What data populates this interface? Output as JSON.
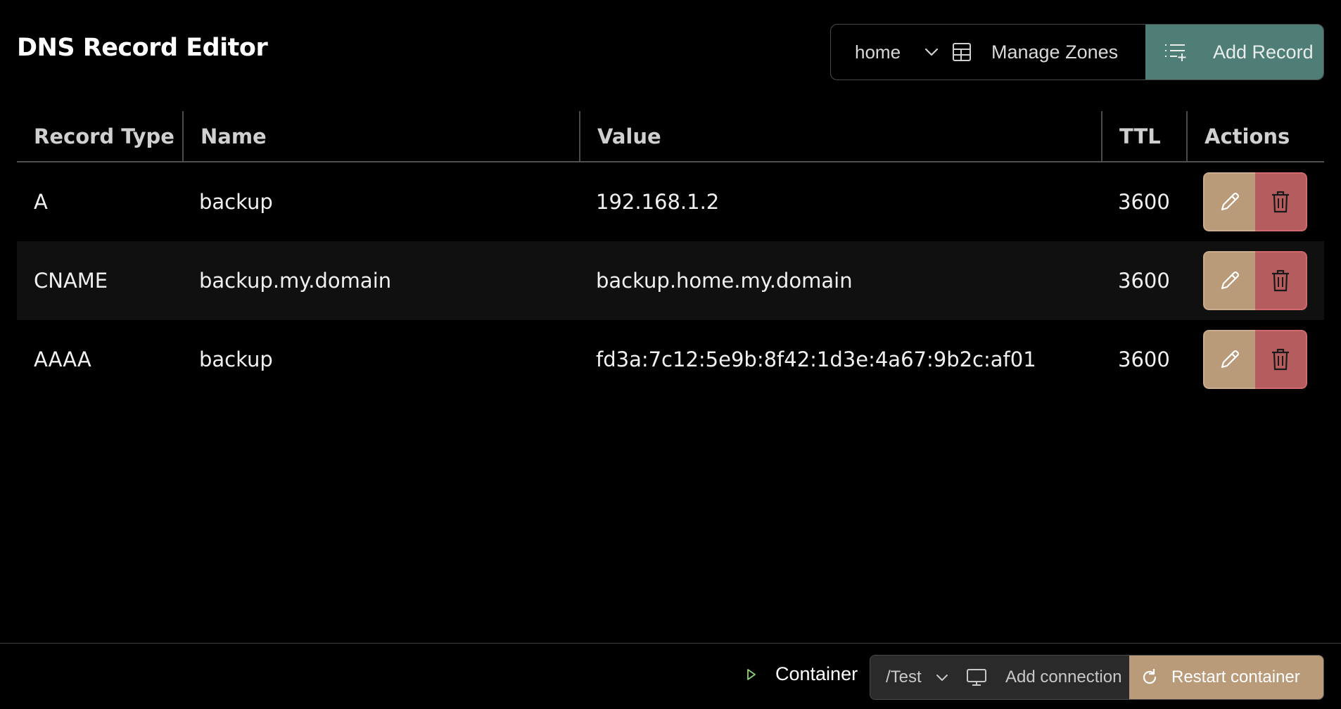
{
  "header": {
    "title": "DNS Record Editor"
  },
  "toolbar": {
    "zone_selected": "home",
    "manage_zones_label": "Manage Zones",
    "add_record_label": "Add Record"
  },
  "table": {
    "columns": [
      "Record Type",
      "Name",
      "Value",
      "TTL",
      "Actions"
    ],
    "rows": [
      {
        "type": "A",
        "name": "backup",
        "value": "192.168.1.2",
        "ttl": "3600"
      },
      {
        "type": "CNAME",
        "name": "backup.my.domain",
        "value": "backup.home.my.domain",
        "ttl": "3600"
      },
      {
        "type": "AAAA",
        "name": "backup",
        "value": "fd3a:7c12:5e9b:8f42:1d3e:4a67:9b2c:af01",
        "ttl": "3600"
      }
    ]
  },
  "bottom_bar": {
    "container_label": "Container",
    "path_selected": "/Test",
    "add_connection_label": "Add connection",
    "restart_label": "Restart container"
  },
  "colors": {
    "background": "#000000",
    "add_record_bg": "#4f7e77",
    "edit_button_bg": "#b99b79",
    "delete_button_bg": "#b55c5e",
    "restart_button_bg": "#b99b79",
    "play_icon": "#8fd17a"
  },
  "icons": {
    "zone_dropdown": "chevron-down-icon",
    "manage_zones": "table-icon",
    "add_record": "list-add-icon",
    "edit": "pencil-icon",
    "delete": "trash-icon",
    "container": "play-icon",
    "path_dropdown": "chevron-down-icon",
    "add_connection": "monitor-icon",
    "restart": "refresh-icon"
  }
}
